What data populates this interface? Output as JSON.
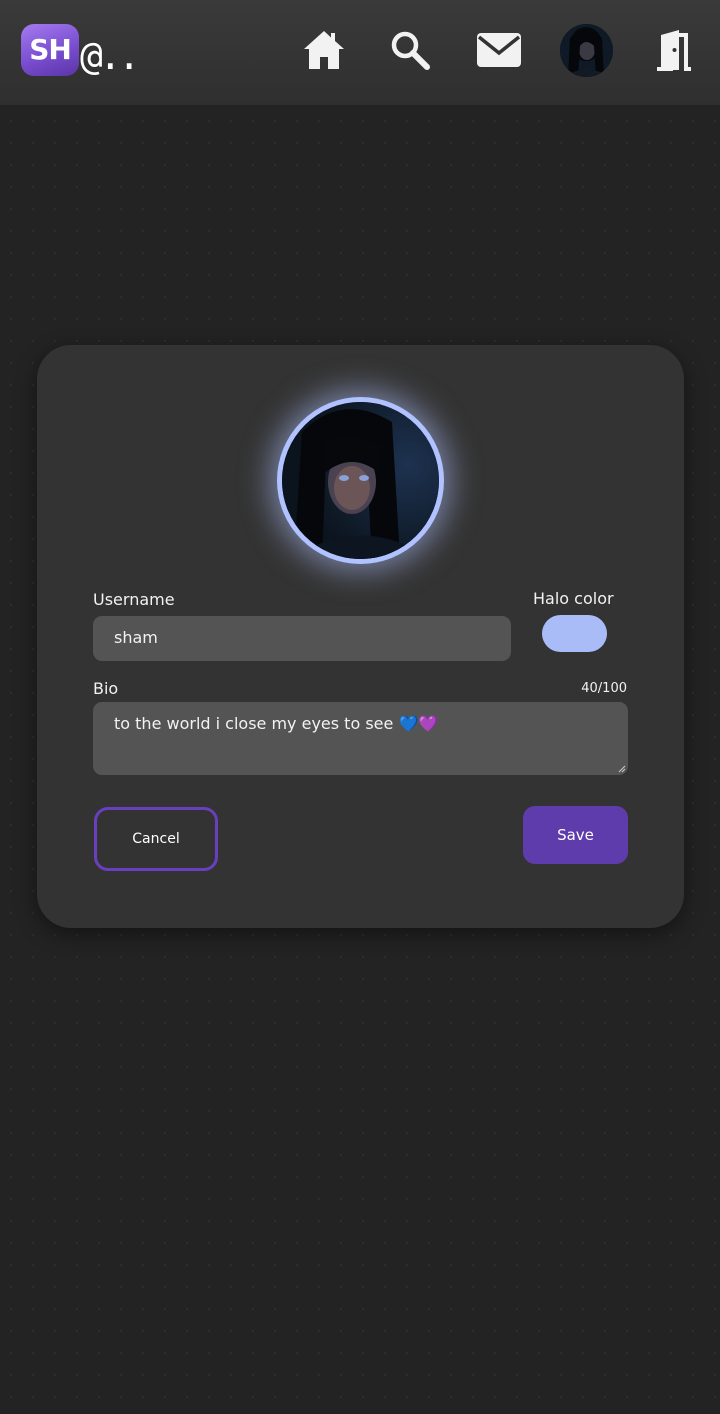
{
  "header": {
    "logo_text": "SH",
    "logo_suffix": "@..",
    "nav": [
      {
        "icon": "home-icon"
      },
      {
        "icon": "search-icon"
      },
      {
        "icon": "mail-icon"
      },
      {
        "icon": "profile-avatar"
      },
      {
        "icon": "logout-door-icon"
      }
    ]
  },
  "profile_form": {
    "username_label": "Username",
    "username_value": "sham",
    "halo_label": "Halo color",
    "halo_color": "#a9bcf8",
    "bio_label": "Bio",
    "bio_value": "to the world i close my eyes to see 💙💜",
    "bio_counter": "40/100",
    "cancel_label": "Cancel",
    "save_label": "Save"
  },
  "colors": {
    "accent": "#5f3cac",
    "accent_border": "#6a3fbf",
    "logo": "#8a5ee0",
    "halo": "#a9bcf8",
    "background": "#232323",
    "card": "#333333",
    "input": "#545454"
  }
}
